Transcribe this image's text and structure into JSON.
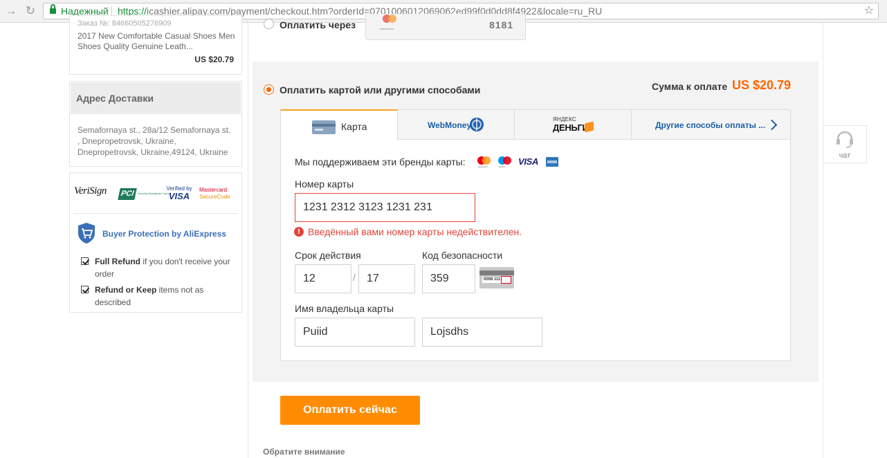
{
  "browser": {
    "secure_label": "Надежный",
    "url_scheme": "https://",
    "url_rest": "icashier.alipay.com/payment/checkout.htm?orderId=0701006012069062ed99f0d0dd8f4922&locale=ru_RU"
  },
  "order": {
    "number_label": "Заказ №: 84660505276909",
    "title": "2017 New Comfortable Casual Shoes Men Shoes Quality Genuine Leath...",
    "price": "US $20.79"
  },
  "address": {
    "heading": "Адрес Доставки",
    "text": "Semafornaya st., 28a/12 Semafornaya st. , Dnepropetrovsk, Ukraine, Dnepropetrovsk, Ukraine,49124, Ukraine"
  },
  "trust": {
    "verisign": "VeriSign",
    "pci": "PCI",
    "pci_small": "Security Standards Council",
    "vbv_top": "Verified by",
    "vbv_visa": "VISA",
    "msc_line1": "Mastercard",
    "msc_line2": "SecureCode",
    "bp_title": "Buyer Protection by AliExpress",
    "items": [
      {
        "bold": "Full Refund",
        "rest": " if you don't receive your order"
      },
      {
        "bold": "Refund or Keep",
        "rest": " items not as described"
      }
    ]
  },
  "saved_method": {
    "label": "Оплатить через",
    "brand_small": "mastercard",
    "digits": "8181"
  },
  "payment": {
    "label": "Оплатить картой или другими способами",
    "sum_label": "Сумма к оплате",
    "sum_value": "US $20.79",
    "accent_color": "#ff6600"
  },
  "tabs": {
    "card": "Карта",
    "webmoney": "WebMoney",
    "yandex_top": "ЯНДЕКС",
    "yandex_bottom": "ДЕНЬГИ",
    "other": "Другие способы оплаты ..."
  },
  "form": {
    "brands_label": "Мы поддерживаем эти бренды карты:",
    "brand_visa": "VISA",
    "brand_mc_small": "mastercard",
    "brand_maestro_small": "maestro",
    "card_number_label": "Номер карты",
    "card_number_value": "1231 2312 3123 1231 231",
    "error_icon": "!",
    "error_text": "Введённый вами номер карты недействителен.",
    "expiry_label": "Срок действия",
    "expiry_month": "12",
    "expiry_sep": "/",
    "expiry_year": "17",
    "cvv_label": "Код безопасности",
    "cvv_value": "359",
    "cvv_sample": "0008 111",
    "holder_label": "Имя владельца карты",
    "first_name": "Puiid",
    "last_name": "Lojsdhs"
  },
  "pay_button": "Оплатить сейчас",
  "note_title": "Обратите внимание",
  "chat_label": "чат"
}
